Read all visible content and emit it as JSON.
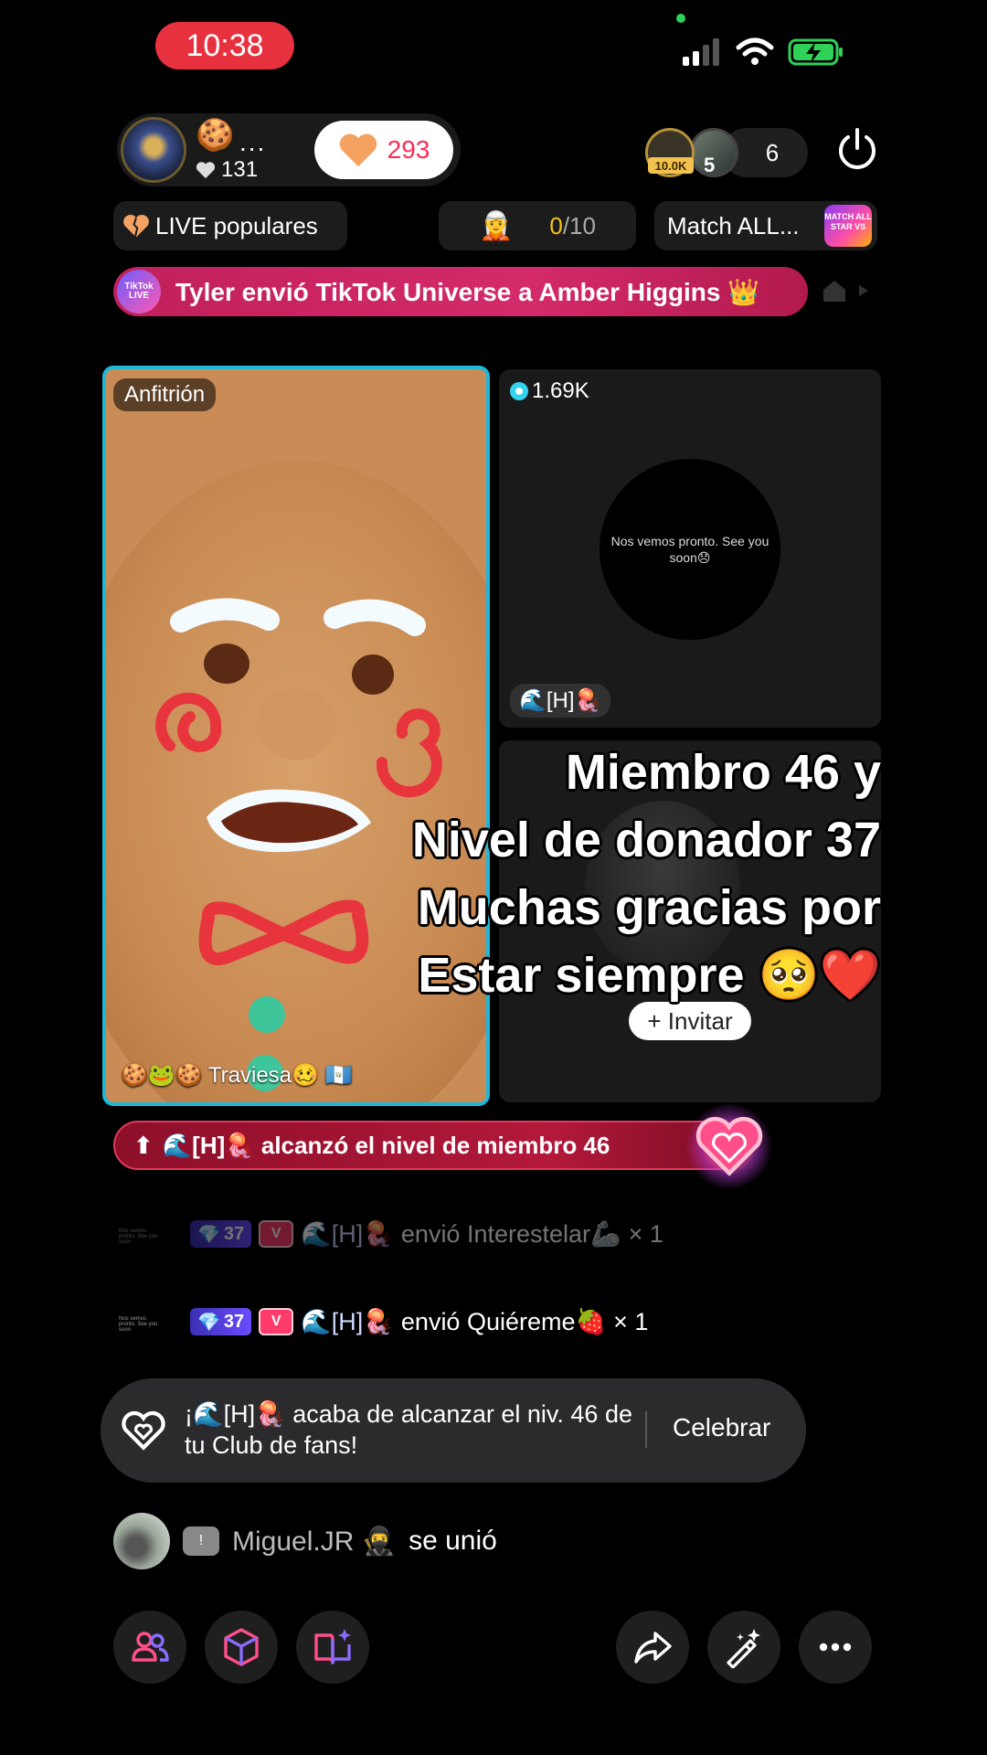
{
  "status_bar": {
    "time": "10:38"
  },
  "host": {
    "emoji": "🍪",
    "dots": "...",
    "likes": "131",
    "follow_count": "293"
  },
  "viewers": {
    "badge": "10.0K",
    "second_num": "5",
    "count": "6"
  },
  "chips": {
    "live_label": "LIVE populares",
    "rank_icon": "🧝",
    "rank_progress_current": "0",
    "rank_progress_total": "/10",
    "match_label": "Match ALL...",
    "match_badge": "MATCH ALL STAR VS"
  },
  "gift_banner": {
    "logo": "TikTok LIVE",
    "text": "Tyler envió TikTok Universe a Amber Higgins 👑"
  },
  "host_panel": {
    "tag": "Anfitrión",
    "name": "🍪🐸🍪 Traviesa🥴 🇬🇹"
  },
  "guest_panel": {
    "coins": "1.69K",
    "message": "Nos vemos pronto. See you soon😞",
    "name": "🌊[H]🪼"
  },
  "empty_panel": {
    "invite": "+ Invitar"
  },
  "caption": {
    "line1": "Miembro 46 y",
    "line2": "Nivel de donador 37",
    "line3": "Muchas gracias por",
    "line4": "Estar siempre 🥺❤️"
  },
  "member_banner": {
    "arrow": "⬆",
    "text": "🌊[H]🪼 alcanzó el nivel de miembro 46"
  },
  "chat": [
    {
      "mini": "Nos vemos pronto. See you soon",
      "level": "37",
      "user": "🌊[H]🪼",
      "message": "envió Interestelar🦾",
      "count": "× 1"
    },
    {
      "mini": "Nos vemos pronto. See you soon",
      "level": "37",
      "user": "🌊[H]🪼",
      "message": "envió Quiéreme🍓",
      "count": "× 1"
    }
  ],
  "fan_notice": {
    "text": "¡🌊[H]🪼 acaba de alcanzar el niv. 46 de tu Club de fans!",
    "button": "Celebrar"
  },
  "join": {
    "badge": "!",
    "user": "Miguel.JR 🥷",
    "action": "se unió"
  },
  "colors": {
    "accent": "#fe2c55",
    "host_border": "#1fb7d8",
    "banner": "#c0205a",
    "member_banner": "#b3183b",
    "level_badge": "#4a3fd0"
  }
}
